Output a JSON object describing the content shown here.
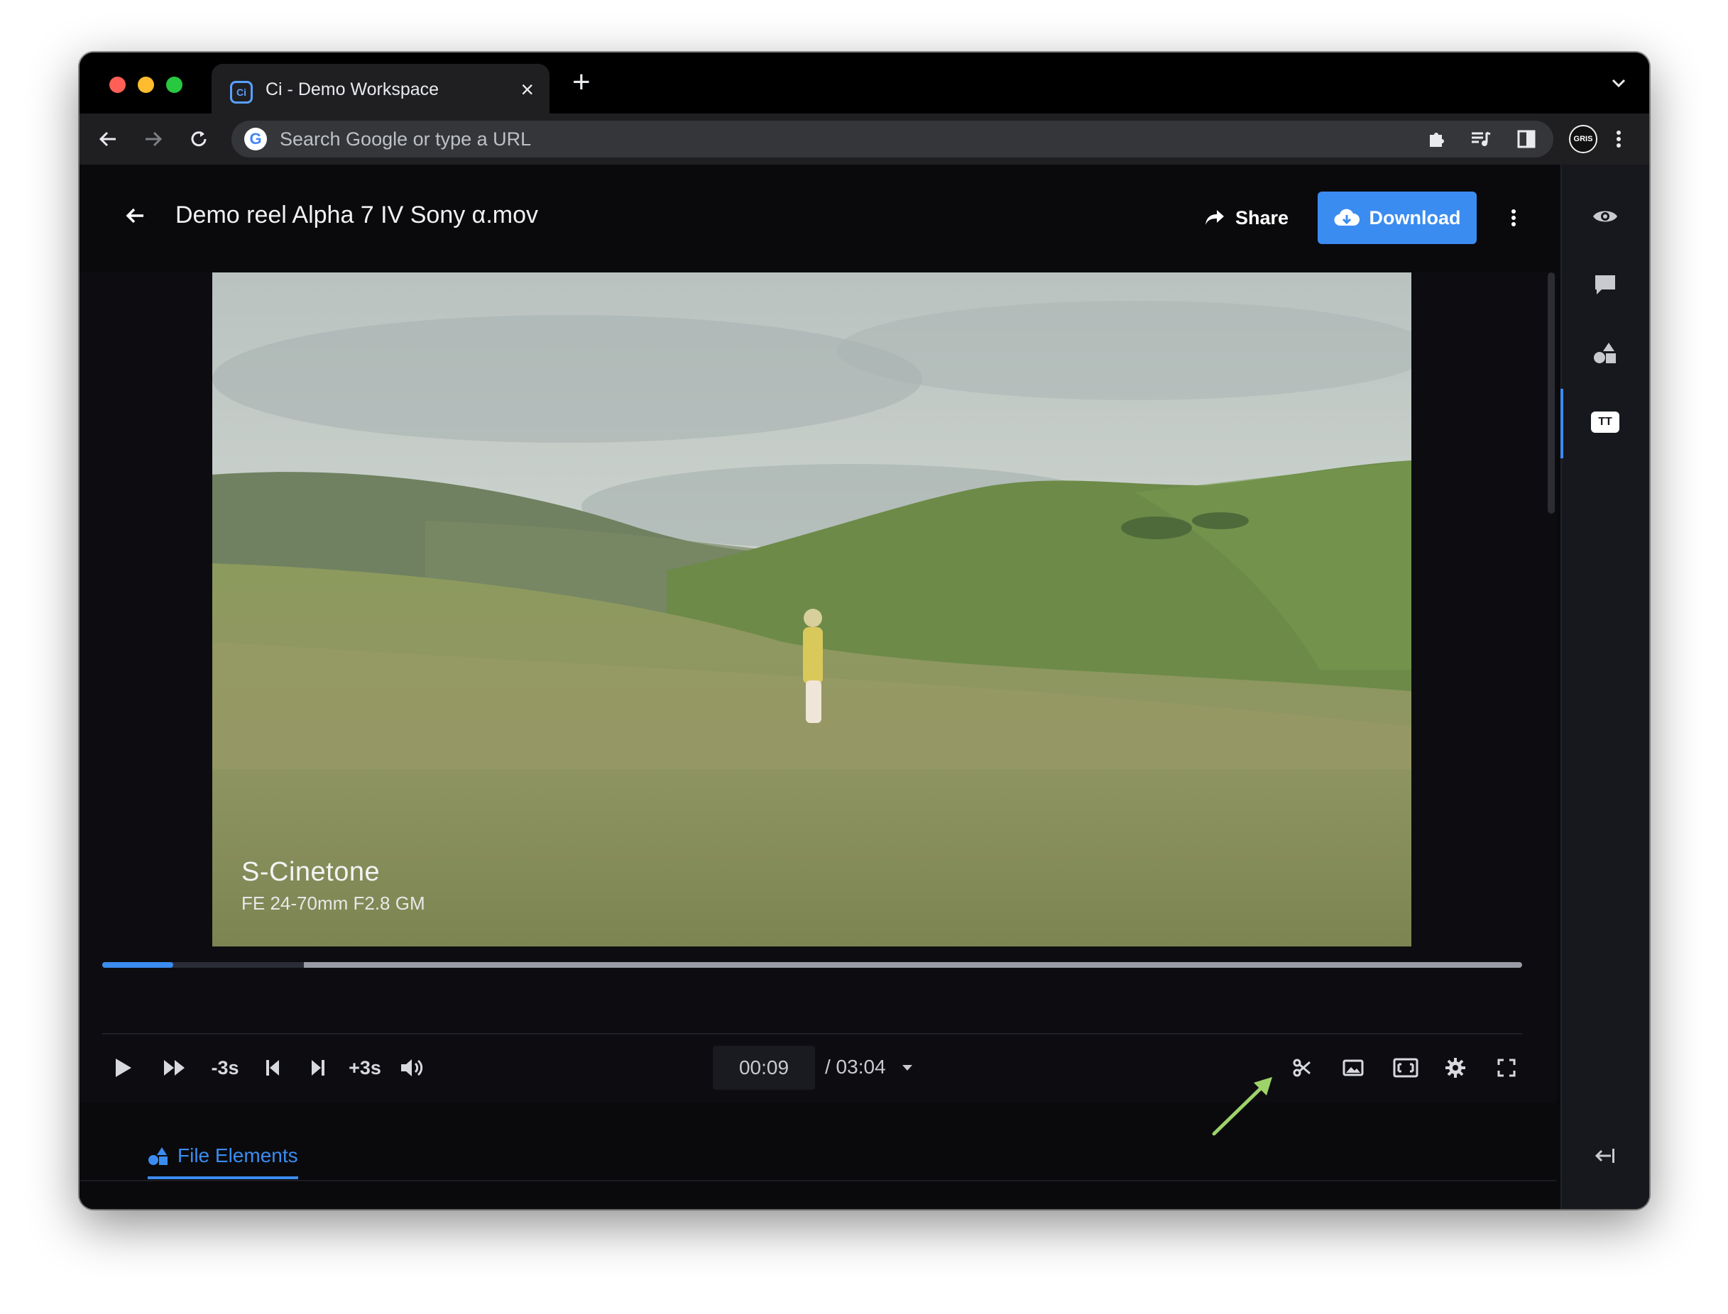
{
  "browser": {
    "tab_title": "Ci - Demo Workspace",
    "tab_favicon_text": "Ci",
    "omnibox_placeholder": "Search Google or type a URL",
    "profile_text": "GRIS"
  },
  "header": {
    "file_title": "Demo reel Alpha 7 IV Sony α.mov",
    "share_label": "Share",
    "download_label": "Download"
  },
  "video": {
    "overlay_title": "S-Cinetone",
    "overlay_subtitle": "FE 24-70mm F2.8 GM"
  },
  "player": {
    "progress_fraction": 0.05,
    "skip_back_label": "-3s",
    "skip_forward_label": "+3s",
    "current_time": "00:09",
    "duration": "/ 03:04"
  },
  "file_tabs": {
    "active_label": "File Elements"
  },
  "colors": {
    "accent": "#3b8cf0",
    "annotation_arrow": "#9ed36a"
  },
  "icons": {
    "rail": [
      "eye-icon",
      "comment-icon",
      "shapes-icon",
      "text-tt-icon",
      "collapse-panel-icon"
    ],
    "controls": [
      "play-icon",
      "fast-forward-icon",
      "previous-frame-icon",
      "next-frame-icon",
      "volume-icon",
      "scissors-icon",
      "image-icon",
      "aspect-ratio-icon",
      "settings-gear-icon",
      "fullscreen-icon"
    ]
  }
}
